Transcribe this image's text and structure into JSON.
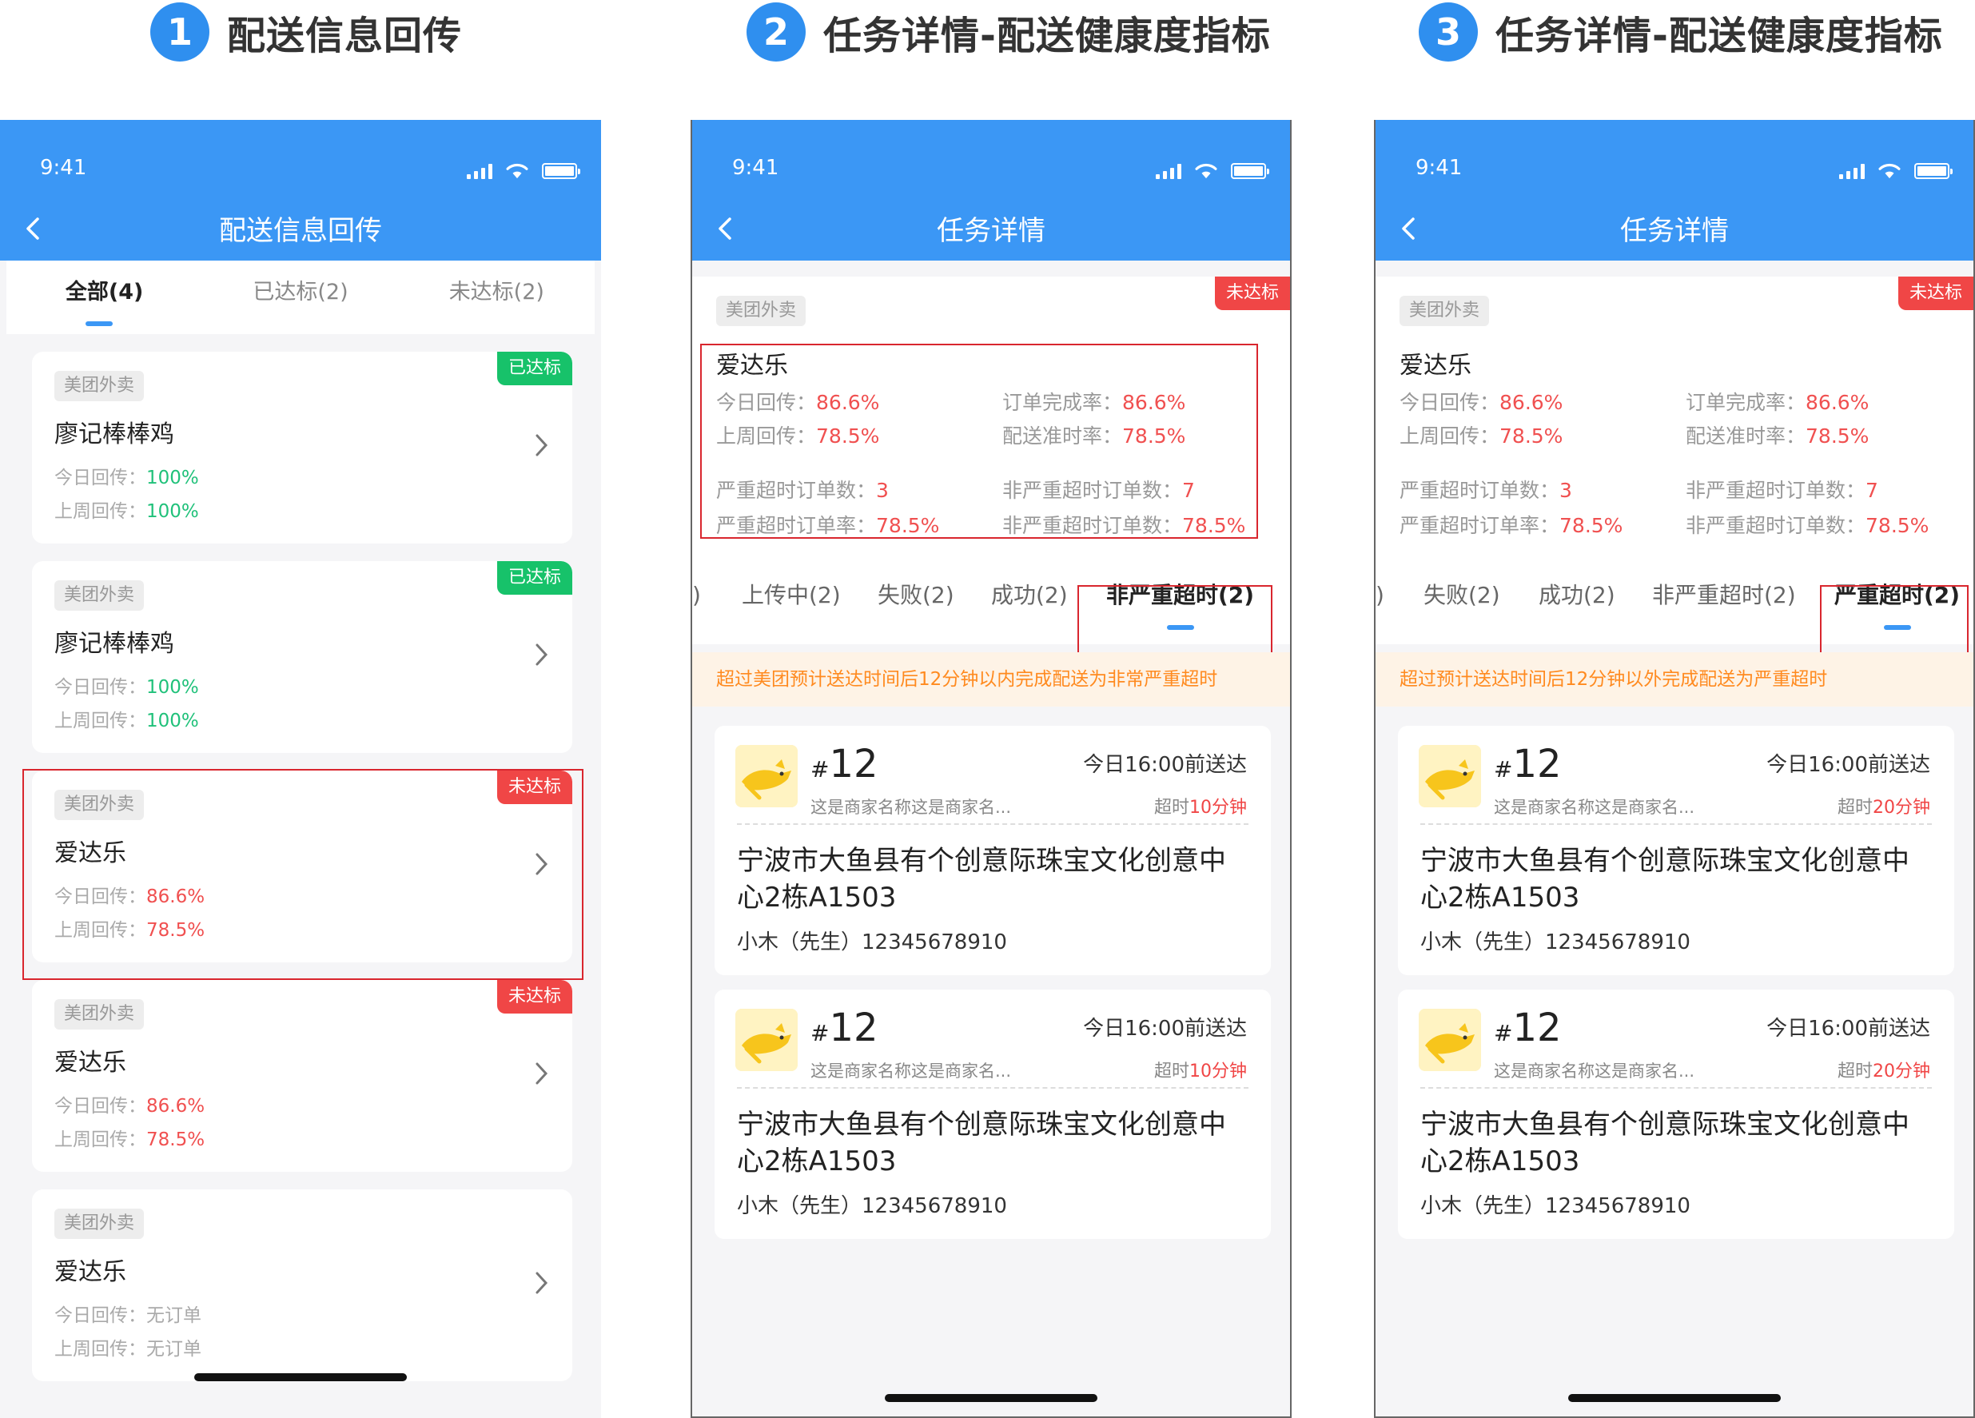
{
  "steps": [
    {
      "num": "1",
      "title": "配送信息回传"
    },
    {
      "num": "2",
      "title": "任务详情-配送健康度指标"
    },
    {
      "num": "3",
      "title": "任务详情-配送健康度指标"
    }
  ],
  "status_time": "9:41",
  "phone1": {
    "title": "配送信息回传",
    "tabs": [
      {
        "label": "全部(4)",
        "active": true
      },
      {
        "label": "已达标(2)",
        "active": false
      },
      {
        "label": "未达标(2)",
        "active": false
      }
    ],
    "labels": {
      "today": "今日回传：",
      "lastweek": "上周回传："
    },
    "cards": [
      {
        "platform": "美团外卖",
        "name": "廖记棒棒鸡",
        "badge": "已达标",
        "badge_type": "ok",
        "today": "100%",
        "lastweek": "100%",
        "value_type": "ok"
      },
      {
        "platform": "美团外卖",
        "name": "廖记棒棒鸡",
        "badge": "已达标",
        "badge_type": "ok",
        "today": "100%",
        "lastweek": "100%",
        "value_type": "ok"
      },
      {
        "platform": "美团外卖",
        "name": "爱达乐",
        "badge": "未达标",
        "badge_type": "bad",
        "today": "86.6%",
        "lastweek": "78.5%",
        "value_type": "bad"
      },
      {
        "platform": "美团外卖",
        "name": "爱达乐",
        "badge": "未达标",
        "badge_type": "bad",
        "today": "86.6%",
        "lastweek": "78.5%",
        "value_type": "bad"
      },
      {
        "platform": "美团外卖",
        "name": "爱达乐",
        "badge": "",
        "badge_type": "",
        "today": "无订单",
        "lastweek": "无订单",
        "value_type": "none"
      }
    ]
  },
  "detail": {
    "title": "任务详情",
    "platform": "美团外卖",
    "badge": "未达标",
    "store_name": "爱达乐",
    "metrics": {
      "today_label": "今日回传：",
      "today": "86.6%",
      "lastweek_label": "上周回传：",
      "lastweek": "78.5%",
      "completion_label": "订单完成率：",
      "completion": "86.6%",
      "ontime_label": "配送准时率：",
      "ontime": "78.5%",
      "severe_count_label": "严重超时订单数：",
      "severe_count": "3",
      "severe_rate_label": "严重超时订单率：",
      "severe_rate": "78.5%",
      "nonsevere_count_label": "非严重超时订单数：",
      "nonsevere_count": "7",
      "nonsevere_rate_label": "非严重超时订单数：",
      "nonsevere_rate": "78.5%"
    },
    "order": {
      "hash": "#",
      "number": "12",
      "merchant": "这是商家名称这是商家名...",
      "deadline": "今日16:00前送达",
      "address": "宁波市大鱼县有个创意际珠宝文化创意中心2栋A1503",
      "contact": "小木（先生）12345678910",
      "overtime_label": "超时"
    }
  },
  "phone2": {
    "tab_fragment": ")",
    "tabs": [
      {
        "label": "上传中(2)",
        "active": false
      },
      {
        "label": "失败(2)",
        "active": false
      },
      {
        "label": "成功(2)",
        "active": false
      },
      {
        "label": "非严重超时(2)",
        "active": true
      }
    ],
    "notice": "超过美团预计送达时间后12分钟以内完成配送为非常严重超时",
    "overtime": "10分钟"
  },
  "phone3": {
    "tab_fragment": ")",
    "tabs": [
      {
        "label": "失败(2)",
        "active": false
      },
      {
        "label": "成功(2)",
        "active": false
      },
      {
        "label": "非严重超时(2)",
        "active": false
      },
      {
        "label": "严重超时(2)",
        "active": true
      }
    ],
    "notice": "超过预计送达时间后12分钟以外完成配送为严重超时",
    "overtime": "20分钟"
  },
  "colors": {
    "primary": "#3b97f5",
    "ok": "#17c26a",
    "bad": "#f04646",
    "highlight": "#d9262e",
    "notice_bg": "#fef3e6",
    "notice_text": "#ff8a1f"
  }
}
